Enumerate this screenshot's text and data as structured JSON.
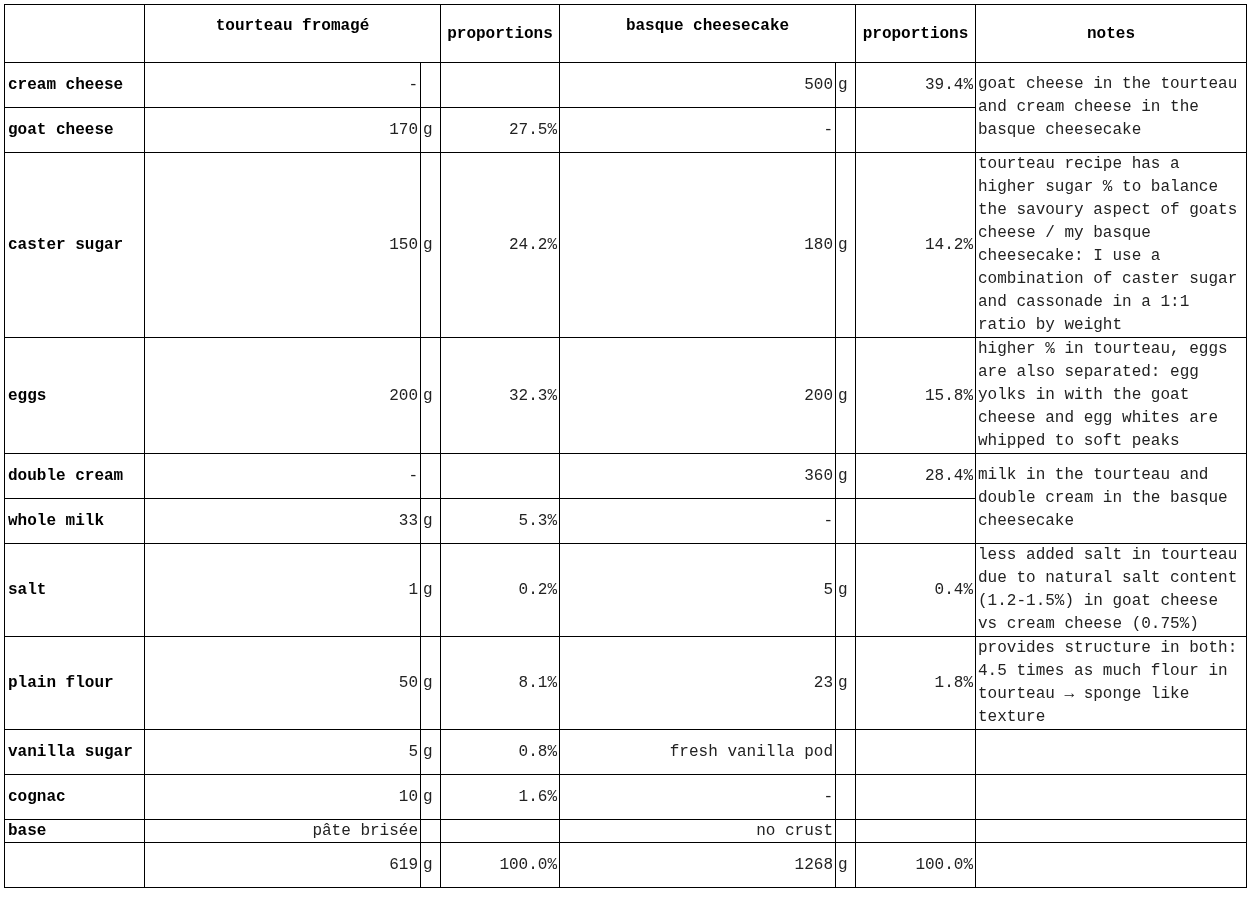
{
  "table": {
    "columns": [
      {
        "kind": "recipe",
        "label": "tourteau fromagé"
      },
      {
        "kind": "proportion",
        "label": "proportions"
      },
      {
        "kind": "recipe",
        "label": "basque cheesecake"
      },
      {
        "kind": "proportion",
        "label": "proportions"
      },
      {
        "kind": "notes",
        "label": "notes"
      }
    ],
    "groups": [
      {
        "note": "goat cheese in the tourteau and cream cheese in the basque cheesecake",
        "rows": [
          {
            "kind": "ingredient",
            "name": "cream cheese",
            "tourteau": {
              "amount": "-"
            },
            "basque": {
              "amount": "500",
              "unit": "g",
              "proportion": "39.4%"
            }
          },
          {
            "kind": "ingredient",
            "name": "goat cheese",
            "tourteau": {
              "amount": "170",
              "unit": "g",
              "proportion": "27.5%"
            },
            "basque": {
              "amount": "-"
            }
          }
        ]
      },
      {
        "note": "tourteau recipe has a higher sugar % to balance the savoury aspect of goats cheese / my basque cheesecake: I use a combination of caster sugar and cassonade in a 1:1 ratio by weight",
        "rows": [
          {
            "kind": "ingredient",
            "name": "caster sugar",
            "tourteau": {
              "amount": "150",
              "unit": "g",
              "proportion": "24.2%"
            },
            "basque": {
              "amount": "180",
              "unit": "g",
              "proportion": "14.2%"
            }
          }
        ]
      },
      {
        "note": "higher % in tourteau, eggs are also separated: egg yolks in with the goat cheese and egg whites are whipped to soft peaks",
        "rows": [
          {
            "kind": "ingredient",
            "name": "eggs",
            "tourteau": {
              "amount": "200",
              "unit": "g",
              "proportion": "32.3%"
            },
            "basque": {
              "amount": "200",
              "unit": "g",
              "proportion": "15.8%"
            }
          }
        ]
      },
      {
        "note": "milk in the tourteau and double cream in the basque cheesecake",
        "rows": [
          {
            "kind": "ingredient",
            "name": "double cream",
            "tourteau": {
              "amount": "-"
            },
            "basque": {
              "amount": "360",
              "unit": "g",
              "proportion": "28.4%"
            }
          },
          {
            "kind": "ingredient",
            "name": "whole milk",
            "tourteau": {
              "amount": "33",
              "unit": "g",
              "proportion": "5.3%"
            },
            "basque": {
              "amount": "-"
            }
          }
        ]
      },
      {
        "note": "less added salt in tourteau due to natural salt content (1.2-1.5%) in goat cheese vs cream cheese (0.75%)",
        "rows": [
          {
            "kind": "ingredient",
            "name": "salt",
            "tourteau": {
              "amount": "1",
              "unit": "g",
              "proportion": "0.2%"
            },
            "basque": {
              "amount": "5",
              "unit": "g",
              "proportion": "0.4%"
            }
          }
        ]
      },
      {
        "note": "provides structure in both: 4.5 times as much flour in tourteau → sponge like texture",
        "rows": [
          {
            "kind": "ingredient",
            "name": "plain flour",
            "tourteau": {
              "amount": "50",
              "unit": "g",
              "proportion": "8.1%"
            },
            "basque": {
              "amount": "23",
              "unit": "g",
              "proportion": "1.8%"
            }
          }
        ]
      },
      {
        "rows": [
          {
            "kind": "ingredient",
            "name": "vanilla sugar",
            "tourteau": {
              "amount": "5",
              "unit": "g",
              "proportion": "0.8%"
            },
            "basque": {
              "amount": "fresh vanilla pod"
            }
          }
        ]
      },
      {
        "rows": [
          {
            "kind": "ingredient",
            "name": "cognac",
            "tourteau": {
              "amount": "10",
              "unit": "g",
              "proportion": "1.6%"
            },
            "basque": {
              "amount": "-"
            }
          }
        ]
      },
      {
        "rows": [
          {
            "kind": "base",
            "name": "base",
            "tourteau": {
              "amount": "pâte brisée"
            },
            "basque": {
              "amount": "no crust"
            }
          }
        ]
      },
      {
        "rows": [
          {
            "kind": "total",
            "tourteau": {
              "amount": "619",
              "unit": "g",
              "proportion": "100.0%"
            },
            "basque": {
              "amount": "1268",
              "unit": "g",
              "proportion": "100.0%"
            }
          }
        ]
      }
    ]
  }
}
